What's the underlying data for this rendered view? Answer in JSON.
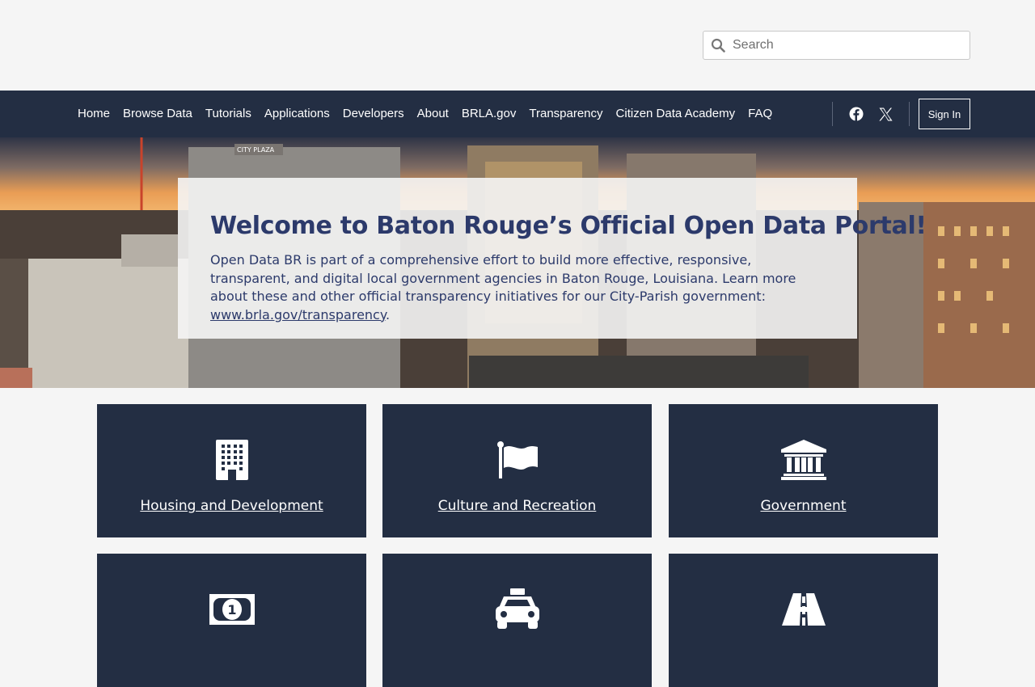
{
  "search": {
    "placeholder": "Search"
  },
  "nav": {
    "items": [
      {
        "label": "Home"
      },
      {
        "label": "Browse Data"
      },
      {
        "label": "Tutorials"
      },
      {
        "label": "Applications"
      },
      {
        "label": "Developers"
      },
      {
        "label": "About"
      },
      {
        "label": "BRLA.gov"
      },
      {
        "label": "Transparency"
      },
      {
        "label": "Citizen Data Academy"
      },
      {
        "label": "FAQ"
      }
    ],
    "social": [
      {
        "icon": "facebook-icon"
      },
      {
        "icon": "x-twitter-icon"
      }
    ],
    "signin_label": "Sign In"
  },
  "hero": {
    "title": "Welcome to Baton Rouge’s Official Open Data Portal!",
    "text": "Open Data BR is part of a comprehensive effort to build more effective, responsive, transparent, and digital local government agencies in Baton Rouge, Louisiana. Learn more about these and other official transparency initiatives for our City-Parish government: ",
    "link": "www.brla.gov/transparency",
    "link_suffix": ".",
    "sign_text": "CITY PLAZA"
  },
  "tiles": [
    {
      "label": "Housing and Development",
      "icon": "building-icon"
    },
    {
      "label": "Culture and Recreation",
      "icon": "flag-icon"
    },
    {
      "label": "Government",
      "icon": "government-building-icon"
    },
    {
      "label": "",
      "icon": "money-bill-icon"
    },
    {
      "label": "",
      "icon": "taxi-icon"
    },
    {
      "label": "",
      "icon": "road-icon"
    }
  ],
  "colors": {
    "navy": "#232e43",
    "title": "#2c3a6b",
    "page_bg": "#f5f5f5"
  }
}
